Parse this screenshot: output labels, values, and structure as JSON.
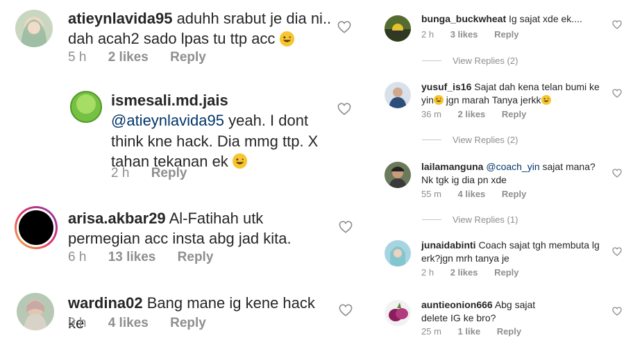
{
  "left_comments": [
    {
      "username": "atieynlavida95",
      "text": "aduhh srabut je dia ni.. dah acah2 sado lpas tu ttp acc",
      "time": "5 h",
      "likes": "2 likes",
      "reply": "Reply"
    },
    {
      "username": "ismesali.md.jais",
      "mention": "@atieynlavida95",
      "text": " yeah. I dont think kne hack. Dia mmg ttp. X tahan tekanan ek",
      "time": "2 h",
      "likes": "",
      "reply": "Reply"
    },
    {
      "username": "arisa.akbar29",
      "text": "Al-Fatihah utk permegian acc insta abg jad kita.",
      "time": "6 h",
      "likes": "13 likes",
      "reply": "Reply"
    },
    {
      "username": "wardina02",
      "text": "Bang mane ig kene hack ke",
      "time": "9 h",
      "likes": "4 likes",
      "reply": "Reply"
    }
  ],
  "right_comments": [
    {
      "username": "bunga_buckwheat",
      "text": "Ig sajat xde ek....",
      "time": "2 h",
      "likes": "3 likes",
      "reply": "Reply",
      "view_replies": "View Replies (2)"
    },
    {
      "username": "yusuf_is16",
      "text": "Sajat dah kena telan bumi ke yin",
      "text2": "jgn marah Tanya jerkk",
      "time": "36 m",
      "likes": "2 likes",
      "reply": "Reply",
      "view_replies": "View Replies (2)"
    },
    {
      "username": "lailamanguna",
      "mention": "@coach_yin",
      "text": " sajat mana? Nk tgk ig dia pn xde",
      "time": "55 m",
      "likes": "4 likes",
      "reply": "Reply",
      "view_replies": "View Replies (1)"
    },
    {
      "username": "junaidabinti",
      "text": "Coach sajat tgh membuta lg erk?jgn mrh tanya je",
      "time": "2 h",
      "likes": "2 likes",
      "reply": "Reply"
    },
    {
      "username": "auntieonion666",
      "text": "Abg sajat delete IG ke bro?",
      "time": "25 m",
      "likes": "1 like",
      "reply": "Reply"
    }
  ],
  "icons": {
    "like": "heart-outline-icon",
    "emoji": "grinning-face-emoji"
  },
  "colors": {
    "text": "#262626",
    "meta": "#8e8e8e",
    "mention": "#003569",
    "heart": "#8e8e8e"
  }
}
